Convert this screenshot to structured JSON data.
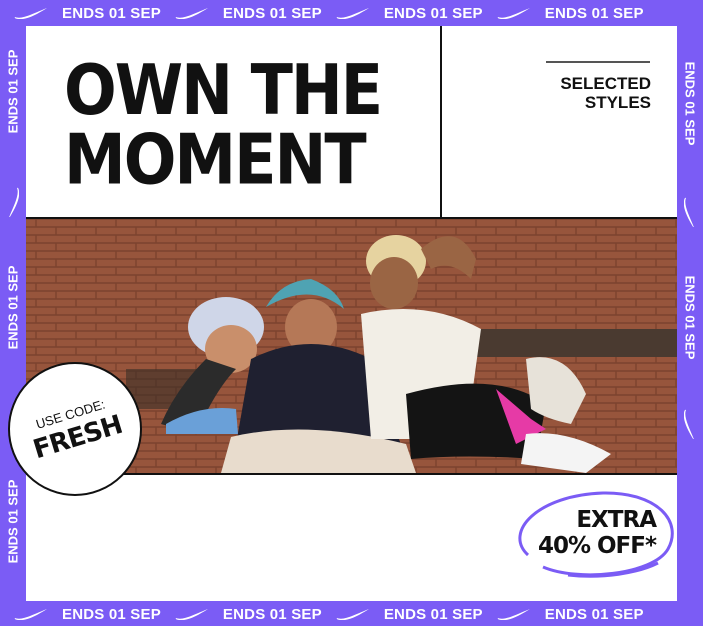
{
  "ticker": {
    "text": "ENDS 01 SEP",
    "icon": "swoosh-icon"
  },
  "headline": {
    "line1": "OWN THE",
    "line2": "MOMENT"
  },
  "styles": {
    "line1": "SELECTED",
    "line2": "STYLES"
  },
  "promo": {
    "label": "USE CODE:",
    "code": "FRESH"
  },
  "offer": {
    "line1": "EXTRA",
    "line2": "40% OFF*"
  },
  "colors": {
    "accent": "#7b5cf5",
    "ink": "#111111",
    "brick": "#8a4a34"
  }
}
